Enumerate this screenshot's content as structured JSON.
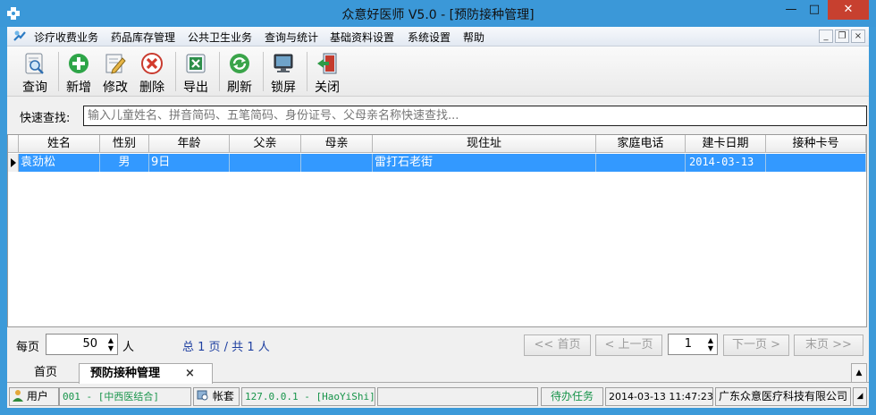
{
  "window": {
    "title": "众意好医师 V5.0 - [预防接种管理]",
    "min_glyph": "—",
    "max_glyph": "□",
    "close_glyph": "✕"
  },
  "menu": {
    "items": [
      "诊疗收费业务",
      "药品库存管理",
      "公共卫生业务",
      "查询与统计",
      "基础资料设置",
      "系统设置",
      "帮助"
    ],
    "mdi_min": "_",
    "mdi_restore": "❐",
    "mdi_close": "×"
  },
  "toolbar": {
    "query": "查询",
    "add": "新增",
    "edit": "修改",
    "delete": "删除",
    "export": "导出",
    "refresh": "刷新",
    "lock": "锁屏",
    "close": "关闭"
  },
  "search": {
    "label": "快速查找:",
    "placeholder": "输入儿童姓名、拼音简码、五笔简码、身份证号、父母亲名称快速查找..."
  },
  "grid": {
    "columns": [
      "姓名",
      "性别",
      "年龄",
      "父亲",
      "母亲",
      "现住址",
      "家庭电话",
      "建卡日期",
      "接种卡号"
    ],
    "rows": [
      {
        "name": "袁劲松",
        "sex": "男",
        "age": "9日",
        "father": "",
        "mother": "",
        "address": "雷打石老街",
        "phone": "",
        "card_date": "2014-03-13",
        "card_no": ""
      }
    ]
  },
  "pager": {
    "per_page_label": "每页",
    "per_page_value": "50",
    "per_page_unit": "人",
    "summary": "总 1 页 / 共 1 人",
    "first": "<< 首页",
    "prev": "< 上一页",
    "page_value": "1",
    "next": "下一页 >",
    "last": "末页 >>"
  },
  "tabs": {
    "home": "首页",
    "active": "预防接种管理",
    "active_close": "×"
  },
  "status": {
    "user_label": "用户",
    "user_value": "001 - [中西医结合]",
    "account_label": "帐套",
    "account_value": "127.0.0.1 - [HaoYiShi]",
    "todo": "待办任务",
    "datetime": "2014-03-13 11:47:23",
    "company": "广东众意医疗科技有限公司"
  },
  "colors": {
    "title_bar": "#3b98d8",
    "close_button": "#c7402f",
    "selected_row": "#3399ff",
    "status_green": "#17944a"
  }
}
